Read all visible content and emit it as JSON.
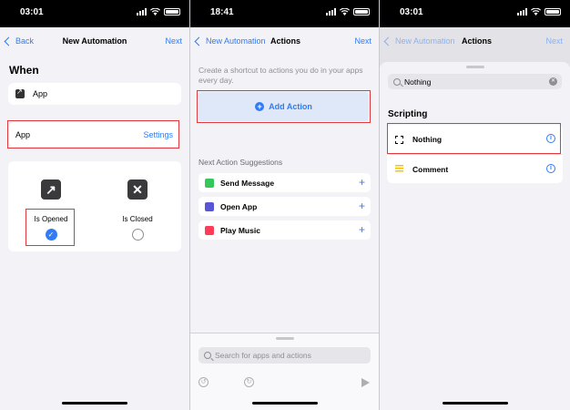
{
  "colors": {
    "accent": "#2f7cf6",
    "highlight": "#e0393e",
    "background": "#f2f2f7"
  },
  "panel1": {
    "status_time": "03:01",
    "nav": {
      "back": "Back",
      "title": "New Automation",
      "next": "Next"
    },
    "when_heading": "When",
    "app_row_label": "App",
    "app_setting": {
      "label": "App",
      "link": "Settings"
    },
    "choices": [
      {
        "label": "Is Opened",
        "icon": "arrow-up-right-icon",
        "glyph": "↗",
        "selected": true
      },
      {
        "label": "Is Closed",
        "icon": "close-box-icon",
        "glyph": "✕",
        "selected": false
      }
    ]
  },
  "panel2": {
    "status_time": "18:41",
    "nav": {
      "back": "New Automation",
      "title": "Actions",
      "next": "Next"
    },
    "hint": "Create a shortcut to actions you do in your apps every day.",
    "add_action": "Add Action",
    "suggestions_heading": "Next Action Suggestions",
    "suggestions": [
      {
        "label": "Send Message",
        "icon": "messages-icon",
        "color": "#34c759"
      },
      {
        "label": "Open App",
        "icon": "open-app-icon",
        "color": "#5856d6"
      },
      {
        "label": "Play Music",
        "icon": "music-icon",
        "color": "#ff3b57"
      }
    ],
    "search_placeholder": "Search for apps and actions"
  },
  "panel3": {
    "status_time": "03:01",
    "nav": {
      "back": "New Automation",
      "title": "Actions",
      "next": "Next"
    },
    "search_value": "Nothing",
    "section": "Scripting",
    "results": [
      {
        "label": "Nothing",
        "icon": "dashed-square-icon"
      },
      {
        "label": "Comment",
        "icon": "comment-lines-icon"
      }
    ]
  }
}
